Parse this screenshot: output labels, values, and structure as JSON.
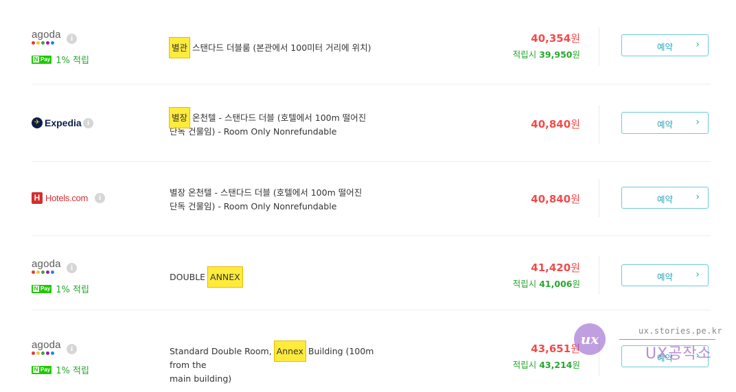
{
  "info_glyph": "i",
  "book_label": "예약",
  "book_chevron": "›",
  "npay_badge": "Pay",
  "npay_n": "N",
  "colors": {
    "price": "#f24a4a",
    "reward": "#26a72d",
    "button_border": "#6dc9d8",
    "highlight": "#ffeb3b",
    "agoda_dots": [
      "#e53935",
      "#fbc02d",
      "#43a047",
      "#8e24aa",
      "#1e88e5"
    ]
  },
  "rows": [
    {
      "provider": "agoda",
      "logo_text": "agoda",
      "npay_text": "1% 적립",
      "room_highlight": "별관",
      "room_rest": " 스탠다드 더블룸 (본관에서 100미터 거리에 위치)",
      "price_num": "40,354",
      "price_unit": "원",
      "reward_prefix": "적립시 ",
      "reward_num": "39,950",
      "reward_unit": "원"
    },
    {
      "provider": "expedia",
      "logo_text": "Expedia",
      "room_highlight": "별장",
      "room_rest": " 온천텔 - 스탠다드 더블 (호텔에서 100m 떨어진",
      "room_line2": "단독 건물임) - Room Only Nonrefundable",
      "price_num": "40,840",
      "price_unit": "원"
    },
    {
      "provider": "hotels",
      "logo_text": "Hotels.com",
      "room_line1": "별장 온천텔 - 스탠다드 더블 (호텔에서 100m 떨어진",
      "room_line2": "단독 건물임) - Room Only Nonrefundable",
      "price_num": "40,840",
      "price_unit": "원"
    },
    {
      "provider": "agoda",
      "logo_text": "agoda",
      "npay_text": "1% 적립",
      "room_prefix": "DOUBLE ",
      "room_highlight": "ANNEX",
      "price_num": "41,420",
      "price_unit": "원",
      "reward_prefix": "적립시 ",
      "reward_num": "41,006",
      "reward_unit": "원"
    },
    {
      "provider": "agoda",
      "logo_text": "agoda",
      "npay_text": "1% 적립",
      "room_prefix": "Standard Double Room, ",
      "room_highlight": "Annex",
      "room_rest": " Building (100m from the",
      "room_line2": "main building)",
      "price_num": "43,651",
      "price_unit": "원",
      "reward_prefix": "적립시 ",
      "reward_num": "43,214",
      "reward_unit": "원"
    }
  ],
  "watermark": {
    "logo_text": "ux",
    "url": "ux.stories.pe.kr",
    "name": "UX공작소"
  }
}
